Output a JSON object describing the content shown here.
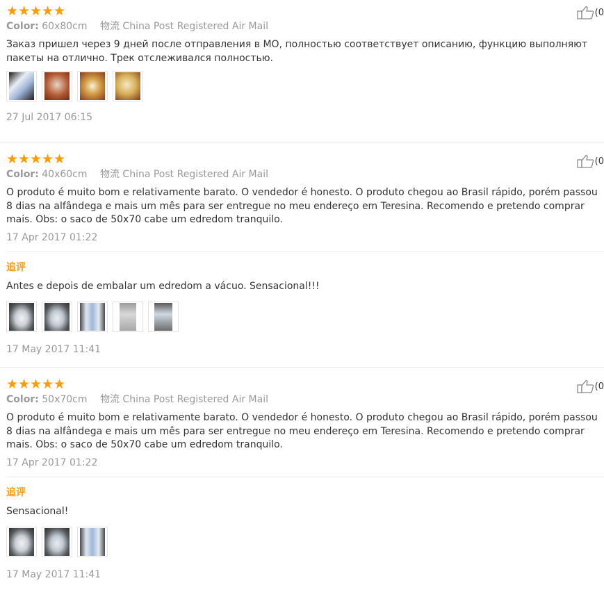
{
  "reviews": [
    {
      "rating": 5,
      "likes": "(0",
      "color_label": "Color:",
      "color_value": "60x80cm",
      "shipping_label": "物流",
      "shipping_value": "China Post Registered Air Mail",
      "text": "Заказ пришел через 9 дней после отправления в МО, полностью соответствует описанию, функцию выполняют пакеты на отлично. Трек отслеживался полностью.",
      "date": "27 Jul 2017 06:15"
    },
    {
      "rating": 5,
      "likes": "(0",
      "color_label": "Color:",
      "color_value": "40x60cm",
      "shipping_label": "物流",
      "shipping_value": "China Post Registered Air Mail",
      "text": "O produto é muito bom e relativamente barato. O vendedor é honesto. O produto chegou ao Brasil rápido, porém passou 8 dias na alfândega e mais um mês para ser entregue no meu endereço em Teresina. Recomendo e pretendo comprar mais. Obs: o saco de 50x70 cabe um edredom tranquilo.",
      "date": "17 Apr 2017 01:22",
      "followup_label": "追评",
      "followup_text": "Antes e depois de embalar um edredom a vácuo. Sensacional!!!",
      "followup_date": "17 May 2017 11:41"
    },
    {
      "rating": 5,
      "likes": "(0",
      "color_label": "Color:",
      "color_value": "50x70cm",
      "shipping_label": "物流",
      "shipping_value": "China Post Registered Air Mail",
      "text": "O produto é muito bom e relativamente barato. O vendedor é honesto. O produto chegou ao Brasil rápido, porém passou 8 dias na alfândega e mais um mês para ser entregue no meu endereço em Teresina. Recomendo e pretendo comprar mais. Obs: o saco de 50x70 cabe um edredom tranquilo.",
      "date": "17 Apr 2017 01:22",
      "followup_label": "追评",
      "followup_text": "Sensacional!",
      "followup_date": "17 May 2017 11:41"
    }
  ],
  "colors": {
    "star": "#ff9a00",
    "meta": "#999999",
    "followup": "#ff9a00"
  }
}
